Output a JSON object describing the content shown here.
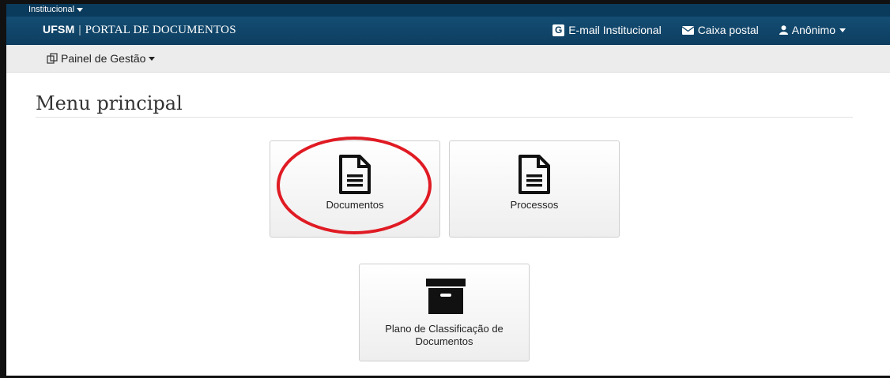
{
  "topbar": {
    "institucional_label": "Institucional"
  },
  "header": {
    "brand_short": "UFSM",
    "brand_separator": "|",
    "brand_title": "PORTAL DE DOCUMENTOS",
    "email_label": "E-mail Institucional",
    "email_icon_letter": "G",
    "mailbox_label": "Caixa postal",
    "user_label": "Anônimo"
  },
  "subbar": {
    "panel_label": "Painel de Gestão"
  },
  "main": {
    "title": "Menu principal",
    "tiles": [
      {
        "label": "Documentos",
        "icon": "document-icon"
      },
      {
        "label": "Processos",
        "icon": "document-icon"
      },
      {
        "label": "Plano de Classificação de Documentos",
        "icon": "archive-box-icon"
      }
    ]
  },
  "colors": {
    "header": "#0d3e60",
    "highlight_circle": "#e01b24"
  }
}
